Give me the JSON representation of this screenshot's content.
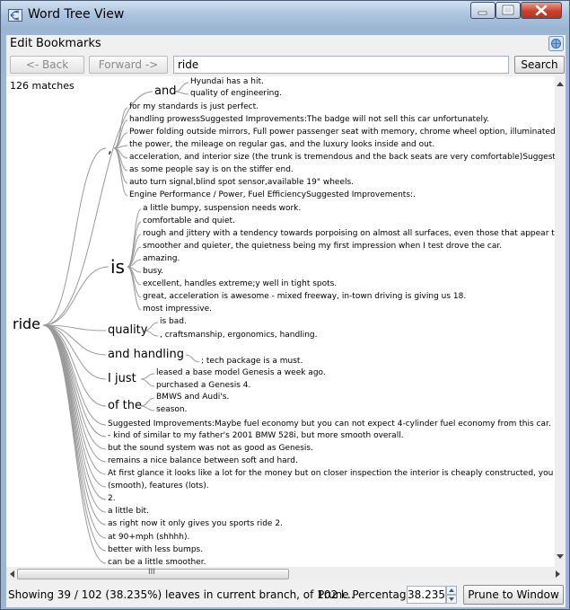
{
  "window": {
    "title": "Word Tree View",
    "icon": "app-tree-icon",
    "controls": {
      "minimize": "minimize-icon",
      "maximize": "maximize-icon",
      "close": "close-icon"
    }
  },
  "menu": {
    "items": [
      "Edit",
      "Bookmarks"
    ],
    "right_icon": "globe-icon"
  },
  "toolbar": {
    "back_label": "<- Back",
    "forward_label": "Forward ->",
    "search_value": "ride",
    "search_label": "Search"
  },
  "tree": {
    "match_count": "126 matches",
    "root": "ride",
    "branches": [
      {
        "label": ","
      },
      {
        "label": "and"
      },
      {
        "label": "is"
      },
      {
        "label": "quality"
      },
      {
        "label": "and handling"
      },
      {
        "label": "I just"
      },
      {
        "label": "of the"
      }
    ],
    "leaves": [
      "Hyundai has a hit.",
      "quality of engineering.",
      "for my standards is just perfect.",
      "handling prowessSuggested Improvements:The badge will not sell this car unfortunately.",
      "Power folding outside mirrors, Full power passenger seat with memory, chrome wheel option, illuminated",
      "the power, the mileage on regular gas, and the luxury looks inside and out.",
      "acceleration, and interior size (the trunk is tremendous and the back seats are very comfortable)Suggest",
      "as some people say is on the stiffer end.",
      "auto turn signal,blind spot sensor,available 19\" wheels.",
      "Engine Performance / Power, Fuel EfficiencySuggested Improvements:.",
      "a little bumpy, suspension needs work.",
      "comfortable and quiet.",
      "rough and jittery with a tendency towards porpoising on almost all surfaces, even those that appear to",
      "smoother and quieter, the quietness being my first impression when I test drove the car.",
      "amazing.",
      "busy.",
      "excellent, handles extreme;y well in tight spots.",
      "great, acceleration is awesome - mixed freeway, in-town driving is giving us 18.",
      "most impressive.",
      "is bad.",
      ", craftsmanship, ergonomics, handling.",
      "; tech package is a must.",
      "leased a base model Genesis a week ago.",
      "purchased a Genesis 4.",
      "BMWS and Audi's.",
      "season.",
      "Suggested Improvements:Maybe fuel economy but you can not expect 4-cylinder fuel economy from this car.",
      "- kind of similar to my father's 2001 BMW 528i, but more smooth overall.",
      "but the sound system was not as good as Genesis.",
      "remains a nice balance between soft and hard.",
      "At first glance it looks like a lot for the money but on closer inspection the interior is cheaply constructed, you cannot",
      "(smooth), features (lots).",
      "2.",
      "a little bit.",
      "as right now it only gives you sports ride 2.",
      "at 90+mph (shhhh).",
      "better with less bumps.",
      "can be a little smoother."
    ]
  },
  "scrollbar": {
    "grip": "III"
  },
  "status": {
    "text": "Showing 39 / 102 (38.235%) leaves in current branch, of 102 l...",
    "prune_label": "Prune Percentage:",
    "prune_value": "38.235",
    "prune_button": "Prune to Window"
  }
}
